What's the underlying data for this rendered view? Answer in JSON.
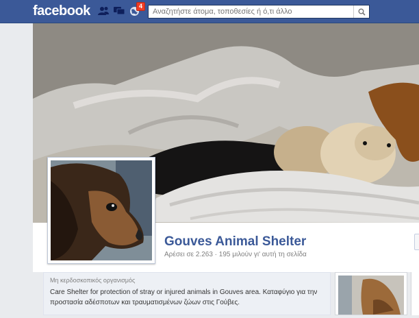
{
  "header": {
    "logo": "facebook",
    "notifications_count": "4",
    "search_placeholder": "Αναζητήστε άτομα, τοποθεσίες ή ό,τι άλλο"
  },
  "page": {
    "name": "Gouves Animal Shelter",
    "stats": "Αρέσει σε 2.263 · 195 μιλούν γι' αυτή τη σελίδα",
    "category": "Μη κερδοσκοπικός οργανισμός",
    "description": "Care Shelter for protection of stray or injured animals in Gouves area. Καταφύγιο για την προστασία αδέσποτων και τραυματισμένων ζώων στις Γούβες."
  },
  "icons": {
    "friends": "friends-icon",
    "messages": "messages-icon",
    "notifications": "globe-icon",
    "search": "search-icon"
  },
  "colors": {
    "brand": "#3b5998",
    "badge": "#f03d25"
  }
}
